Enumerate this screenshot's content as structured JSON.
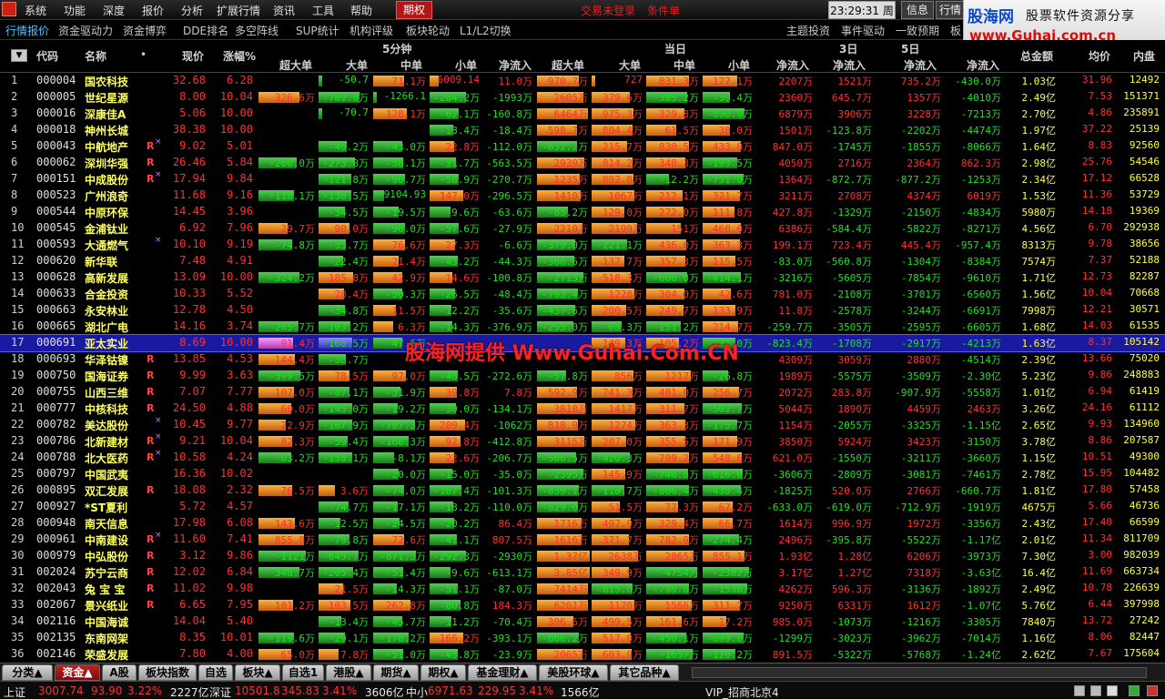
{
  "menubar": {
    "items": [
      "系统",
      "功能",
      "深度",
      "报价",
      "分析",
      "扩展行情",
      "资讯",
      "工具",
      "帮助"
    ],
    "active_tab": "期权",
    "login_status": "交易未登录",
    "condition_order": "条件单",
    "clock": "23:29:31 周二",
    "info_button": "信息",
    "quote_button": "行情"
  },
  "logo": {
    "brand": "股海网",
    "tagline": "股票软件资源分享",
    "url": "www.Guhai.com.cn"
  },
  "toolbar2": {
    "items": [
      "行情报价",
      "资金驱动力",
      "资金博弈",
      "DDE排名",
      "多空阵线",
      "SUP统计",
      "机构评级",
      "板块轮动",
      "L1/L2切换"
    ],
    "right_items": [
      "主题投资",
      "事件驱动",
      "一致预期",
      "板"
    ]
  },
  "header": {
    "code": "代码",
    "name": "名称",
    "dot": "•",
    "price": "现价",
    "change": "涨幅%",
    "group5": "5分钟",
    "group_today": "当日",
    "cols5": [
      "超大单",
      "大单",
      "中单",
      "小单",
      "净流入"
    ],
    "cols_today": [
      "超大单",
      "大单",
      "中单",
      "小单",
      "净流入"
    ],
    "d3": "3日",
    "d3b": "净流入",
    "d5": "5日",
    "d5b": "净流入",
    "net4": "净流入",
    "total_amount": "总金额",
    "avg": "均价",
    "inner": "内盘"
  },
  "rows": [
    {
      "n": "1",
      "code": "000004",
      "name": "国农科技",
      "price": "32.68",
      "chg": "6.28",
      "m": "",
      "f": [
        "",
        "-50.7",
        "71.1万",
        "6009.14",
        "11.0万",
        "970.7万",
        "727",
        "831.3万",
        "177.1万",
        "2207万",
        "1521万",
        "735.2万",
        "-430.0万",
        "1.03亿",
        "31.96",
        "12492"
      ]
    },
    {
      "n": "2",
      "code": "000005",
      "name": "世纪星源",
      "price": "8.00",
      "chg": "10.04",
      "m": "",
      "f": [
        "326.6万",
        "-769.0万",
        "-1266.1",
        "-284.2万",
        "-1993万",
        "2605万",
        "379.6万",
        "-585.2万",
        "-39.4万",
        "2360万",
        "645.7万",
        "1357万",
        "-4010万",
        "2.49亿",
        "7.53",
        "151371"
      ]
    },
    {
      "n": "3",
      "code": "000016",
      "name": "深康佳A",
      "price": "5.06",
      "chg": "10.00",
      "m": "",
      "f": [
        "",
        "-70.7",
        "128.1万",
        "-62.1万",
        "-160.8万",
        "6464万",
        "975.3万",
        "329.8万",
        "-890.0万",
        "6879万",
        "3906万",
        "3228万",
        "-7213万",
        "2.70亿",
        "4.86",
        "235891"
      ]
    },
    {
      "n": "4",
      "code": "000018",
      "name": "神州长城",
      "price": "38.38",
      "chg": "10.00",
      "m": "",
      "f": [
        "",
        "",
        "",
        "-18.4万",
        "-18.4万",
        "598.7万",
        "804.4万",
        "61.5万",
        "38.0万",
        "1501万",
        "-123.8万",
        "-2202万",
        "-4474万",
        "1.97亿",
        "37.22",
        "25139"
      ]
    },
    {
      "n": "5",
      "code": "000043",
      "name": "中航地产",
      "price": "9.02",
      "chg": "5.01",
      "m": "Rx",
      "f": [
        "",
        "-46.2万",
        "-43.0万",
        "22.8万",
        "-112.0万",
        "-632.2万",
        "215.7万",
        "830.5万",
        "433.0万",
        "847.0万",
        "-1745万",
        "-1855万",
        "-8066万",
        "1.64亿",
        "8.83",
        "92560"
      ]
    },
    {
      "n": "6",
      "code": "000062",
      "name": "深圳华强",
      "price": "26.46",
      "chg": "5.84",
      "m": "R",
      "f": [
        "-200.0万",
        "-273.8万",
        "-58.1万",
        "-31.7万",
        "-563.5万",
        "2939万",
        "814.2万",
        "348.3万",
        "-193.5万",
        "4050万",
        "2716万",
        "2364万",
        "862.3万",
        "2.98亿",
        "25.76",
        "54546"
      ]
    },
    {
      "n": "7",
      "code": "000151",
      "name": "中成股份",
      "price": "17.94",
      "chg": "9.84",
      "m": "Rx",
      "f": [
        "",
        "-121.8万",
        "-90.7万",
        "-58.9万",
        "-270.7万",
        "1235万",
        "892.0万",
        "-12.2万",
        "-751.0万",
        "1364万",
        "-872.7万",
        "-877.2万",
        "-1253万",
        "2.34亿",
        "17.12",
        "66528"
      ]
    },
    {
      "n": "8",
      "code": "000523",
      "name": "广州浪奇",
      "price": "11.68",
      "chg": "9.16",
      "m": "",
      "f": [
        "-118.1万",
        "-130.5万",
        "-9104.93",
        "147.0万",
        "-296.5万",
        "1410万",
        "1067万",
        "212.1万",
        "321.7万",
        "3211万",
        "2708万",
        "4374万",
        "6019万",
        "1.53亿",
        "11.36",
        "53729"
      ]
    },
    {
      "n": "9",
      "code": "000544",
      "name": "中原环保",
      "price": "14.45",
      "chg": "3.96",
      "m": "",
      "f": [
        "",
        "-34.5万",
        "-19.5万",
        "-9.6万",
        "-63.6万",
        "-85.2万",
        "129.0万",
        "272.0万",
        "111.8万",
        "427.8万",
        "-1329万",
        "-2150万",
        "-4834万",
        "5980万",
        "14.18",
        "19369"
      ]
    },
    {
      "n": "10",
      "code": "000545",
      "name": "金浦钛业",
      "price": "6.92",
      "chg": "7.96",
      "m": "",
      "f": [
        "29.7万",
        "90.0万",
        "-90.0万",
        "-57.6万",
        "-27.9万",
        "2210万",
        "2199万",
        "151万",
        "460.0万",
        "6386万",
        "-584.4万",
        "-5822万",
        "-8271万",
        "4.56亿",
        "6.70",
        "292938"
      ]
    },
    {
      "n": "11",
      "code": "000593",
      "name": "大通燃气",
      "price": "10.10",
      "chg": "9.19",
      "m": "x",
      "f": [
        "-74.8万",
        "-35.7万",
        "76.6万",
        "27.3万",
        "-6.6万",
        "-379.0万",
        "-221.1万",
        "436.0万",
        "363.3万",
        "199.1万",
        "723.4万",
        "445.4万",
        "-957.4万",
        "8313万",
        "9.78",
        "38656"
      ]
    },
    {
      "n": "12",
      "code": "000620",
      "name": "新华联",
      "price": "7.48",
      "chg": "4.91",
      "m": "",
      "f": [
        "",
        "-22.4万",
        "21.4万",
        "-43.2万",
        "-44.3万",
        "-366.6万",
        "137.7万",
        "357.3万",
        "115.5万",
        "-83.0万",
        "-560.8万",
        "-1304万",
        "-8384万",
        "7574万",
        "7.37",
        "52188"
      ]
    },
    {
      "n": "13",
      "code": "000628",
      "name": "高新发展",
      "price": "13.09",
      "chg": "10.00",
      "m": "",
      "f": [
        "-324.2万",
        "185.8万",
        "42.9万",
        "14.6万",
        "-100.8万",
        "-2713万",
        "518.3万",
        "-606.8万",
        "-414.1万",
        "-3216万",
        "-5605万",
        "-7854万",
        "-9610万",
        "1.71亿",
        "12.73",
        "82287"
      ]
    },
    {
      "n": "14",
      "code": "000633",
      "name": "合金投资",
      "price": "10.33",
      "chg": "5.52",
      "m": "",
      "f": [
        "",
        "28.4万",
        "-50.3万",
        "-26.5万",
        "-48.4万",
        "-793.4万",
        "1228万",
        "304.0万",
        "42.6万",
        "781.0万",
        "-2108万",
        "-3701万",
        "-6560万",
        "1.56亿",
        "10.04",
        "70668"
      ]
    },
    {
      "n": "15",
      "code": "000663",
      "name": "永安林业",
      "price": "12.78",
      "chg": "4.50",
      "m": "",
      "f": [
        "",
        "-34.8万",
        "11.5万",
        "-12.2万",
        "-35.6万",
        "-437.6万",
        "200.5万",
        "249.7万",
        "133.9万",
        "11.8万",
        "-2578万",
        "-3244万",
        "-6691万",
        "7998万",
        "12.21",
        "30571"
      ]
    },
    {
      "n": "16",
      "code": "000665",
      "name": "湖北广电",
      "price": "14.16",
      "chg": "3.74",
      "m": "",
      "f": [
        "-265.7万",
        "-103.2万",
        "6.3万",
        "-14.3万",
        "-376.9万",
        "-255.0万",
        "-68.3万",
        "-151.2万",
        "214.7万",
        "-259.7万",
        "-3505万",
        "-2595万",
        "-6605万",
        "1.68亿",
        "14.03",
        "61535"
      ]
    },
    {
      "n": "17",
      "code": "000691",
      "name": "亚太实业",
      "price": "8.69",
      "chg": "10.00",
      "m": "",
      "sel": true,
      "f": [
        "91.4万",
        "-168.5万",
        "-47.6万",
        "",
        "",
        "",
        "149.3万",
        "105.2万",
        "-121.0万",
        "-823.4万",
        "-1708万",
        "-2917万",
        "-4213万",
        "1.63亿",
        "8.37",
        "105142"
      ]
    },
    {
      "n": "18",
      "code": "000693",
      "name": "华泽钴镍",
      "price": "13.85",
      "chg": "4.53",
      "m": "R",
      "f": [
        "144.4万",
        "-38.7万",
        "",
        "",
        "",
        "",
        "",
        "",
        "",
        "4309万",
        "3059万",
        "2880万",
        "-4514万",
        "2.39亿",
        "13.66",
        "75020"
      ]
    },
    {
      "n": "19",
      "code": "000750",
      "name": "国海证券",
      "price": "9.99",
      "chg": "3.63",
      "m": "R",
      "f": [
        "-399.5万",
        "78.5万",
        "97.0万",
        "-48.5万",
        "-272.6万",
        "-57.8万",
        "856万",
        "1217万",
        "-26.8万",
        "1989万",
        "-5575万",
        "-3509万",
        "-2.30亿",
        "5.23亿",
        "9.86",
        "248883"
      ]
    },
    {
      "n": "20",
      "code": "000755",
      "name": "山西三维",
      "price": "7.07",
      "chg": "7.77",
      "m": "R",
      "f": [
        "107.0万",
        "-87.1万",
        "-31.9万",
        "39.8万",
        "7.8万",
        "592.9万",
        "741.3万",
        "481.0万",
        "256.7万",
        "2072万",
        "283.8万",
        "-907.9万",
        "-5558万",
        "1.01亿",
        "6.94",
        "61419"
      ]
    },
    {
      "n": "21",
      "code": "000777",
      "name": "中核科技",
      "price": "24.50",
      "chg": "4.88",
      "m": "R",
      "f": [
        "60.0万",
        "-145.0万",
        "-19.2万",
        "-30.0万",
        "-134.1万",
        "3818万",
        "1417万",
        "311.7万",
        "-502.7万",
        "5044万",
        "1890万",
        "4459万",
        "2463万",
        "3.26亿",
        "24.16",
        "61112"
      ]
    },
    {
      "n": "22",
      "code": "000782",
      "name": "美达股份",
      "price": "10.45",
      "chg": "9.77",
      "m": "x",
      "f": [
        "22.9万",
        "-167.9万",
        "-707.3万",
        "209.4万",
        "-1062万",
        "818.9万",
        "1274万",
        "363.3万",
        "-175.7万",
        "1154万",
        "-2055万",
        "-3325万",
        "-1.15亿",
        "2.65亿",
        "9.93",
        "134960"
      ]
    },
    {
      "n": "23",
      "code": "000786",
      "name": "北新建材",
      "price": "9.21",
      "chg": "10.04",
      "m": "Rx",
      "f": [
        "82.3万",
        "-59.4万",
        "-168.3万",
        "92.8万",
        "-412.8万",
        "3115万",
        "207.0万",
        "355.5万",
        "171.9万",
        "3850万",
        "5924万",
        "3423万",
        "-3150万",
        "3.78亿",
        "8.86",
        "207587"
      ]
    },
    {
      "n": "24",
      "code": "000788",
      "name": "北大医药",
      "price": "10.58",
      "chg": "4.24",
      "m": "Rx",
      "f": [
        "-63.2万",
        "-158.1万",
        "-8.1万",
        "22.6万",
        "-206.7万",
        "-506.5万",
        "-420.3万",
        "799.2万",
        "548.6万",
        "621.0万",
        "-1550万",
        "-3211万",
        "-3660万",
        "1.15亿",
        "10.51",
        "49300"
      ]
    },
    {
      "n": "25",
      "code": "000797",
      "name": "中国武夷",
      "price": "16.36",
      "chg": "10.02",
      "m": "",
      "f": [
        "",
        "",
        "-20.0万",
        "-15.0万",
        "-35.0万",
        "-2395万",
        "145.9万",
        "-740.8万",
        "-616.0万",
        "-3606万",
        "-2809万",
        "-3081万",
        "-7461万",
        "2.78亿",
        "15.95",
        "104482"
      ]
    },
    {
      "n": "26",
      "code": "000895",
      "name": "双汇发展",
      "price": "18.08",
      "chg": "2.32",
      "m": "R",
      "f": [
        "76.5万",
        "3.6万",
        "-74.0万",
        "-107.4万",
        "-101.3万",
        "-839.1万",
        "-118.7万",
        "-866.4万",
        "-438.4万",
        "-1825万",
        "520.0万",
        "2766万",
        "-660.7万",
        "1.81亿",
        "17.80",
        "57458"
      ]
    },
    {
      "n": "27",
      "code": "000927",
      "name": "*ST夏利",
      "price": "5.72",
      "chg": "4.57",
      "m": "",
      "f": [
        "",
        "-74.7万",
        "-17.1万",
        "-18.2万",
        "-110.0万",
        "-829.0万",
        "51.5万",
        "77.3万",
        "67.2万",
        "-633.0万",
        "-619.0万",
        "-712.9万",
        "-1919万",
        "4675万",
        "5.66",
        "46736"
      ]
    },
    {
      "n": "28",
      "code": "000948",
      "name": "南天信息",
      "price": "17.98",
      "chg": "6.08",
      "m": "",
      "f": [
        "143.6万",
        "-12.5万",
        "-24.5万",
        "-20.2万",
        "86.4万",
        "1716万",
        "497.9万",
        "329.4万",
        "66.7万",
        "1614万",
        "996.9万",
        "1972万",
        "-3356万",
        "2.43亿",
        "17.40",
        "66599"
      ]
    },
    {
      "n": "29",
      "code": "000961",
      "name": "中南建设",
      "price": "11.60",
      "chg": "7.41",
      "m": "Rx",
      "f": [
        "855.8万",
        "-79.8万",
        "72.6万",
        "-41.1万",
        "807.5万",
        "1616万",
        "371.7万",
        "782.9万",
        "-274.4万",
        "2496万",
        "-395.8万",
        "-5522万",
        "-1.17亿",
        "2.01亿",
        "11.34",
        "811709"
      ]
    },
    {
      "n": "30",
      "code": "000979",
      "name": "中弘股份",
      "price": "3.12",
      "chg": "9.86",
      "m": "R",
      "f": [
        "-1121万",
        "-645.7万",
        "-871.3万",
        "-292.3万",
        "-2930万",
        "1.37亿",
        "2638万",
        "2065万",
        "855.1万",
        "1.93亿",
        "1.28亿",
        "6206万",
        "-3973万",
        "7.30亿",
        "3.00",
        "982039"
      ]
    },
    {
      "n": "31",
      "code": "002024",
      "name": "苏宁云商",
      "price": "12.02",
      "chg": "6.84",
      "m": "R",
      "f": [
        "-348.7万",
        "-205.4万",
        "-51.4万",
        "-9.6万",
        "-613.1万",
        "3.85亿",
        "349.9万",
        "-4754万",
        "-2382万",
        "3.17亿",
        "1.27亿",
        "7318万",
        "-3.63亿",
        "16.4亿",
        "11.69",
        "663734"
      ]
    },
    {
      "n": "32",
      "code": "002043",
      "name": "兔 宝 宝",
      "price": "11.02",
      "chg": "9.98",
      "m": "R",
      "f": [
        "",
        "21.5万",
        "-14.3万",
        "-51.1万",
        "-87.0万",
        "7414万",
        "-815.0万",
        "-799.8万",
        "-1538万",
        "4262万",
        "596.3万",
        "-3136万",
        "-1892万",
        "2.49亿",
        "10.78",
        "226639"
      ]
    },
    {
      "n": "33",
      "code": "002067",
      "name": "景兴纸业",
      "price": "6.65",
      "chg": "7.95",
      "m": "R",
      "f": [
        "101.2万",
        "103.5万",
        "262.8万",
        "-80.8万",
        "184.3万",
        "6201万",
        "1170万",
        "1566万",
        "311.7万",
        "9250万",
        "6331万",
        "1612万",
        "-1.07亿",
        "5.76亿",
        "6.44",
        "397998"
      ]
    },
    {
      "n": "34",
      "code": "002116",
      "name": "中国海诚",
      "price": "14.04",
      "chg": "5.40",
      "m": "",
      "f": [
        "",
        "-13.4万",
        "-45.7万",
        "-11.2万",
        "-70.4万",
        "306.6万",
        "499.5万",
        "161.6万",
        "17.2万",
        "985.0万",
        "-1073万",
        "-1216万",
        "-3305万",
        "7840万",
        "13.72",
        "27242"
      ]
    },
    {
      "n": "35",
      "code": "002135",
      "name": "东南网架",
      "price": "8.35",
      "chg": "10.01",
      "m": "",
      "f": [
        "-119.6万",
        "-29.1万",
        "-178.2万",
        "166.2万",
        "-393.1万",
        "-866.2万",
        "517.0万",
        "-450.1万",
        "-699.6万",
        "-1299万",
        "-3023万",
        "-3962万",
        "-7014万",
        "1.16亿",
        "8.06",
        "82447"
      ]
    },
    {
      "n": "36",
      "code": "002146",
      "name": "荣盛发展",
      "price": "7.80",
      "chg": "4.00",
      "m": "",
      "f": [
        "65.0万",
        "7.8万",
        "-51.0万",
        "-45.8万",
        "-23.9万",
        "2065万",
        "603.9万",
        "-1657万",
        "-120.2万",
        "891.5万",
        "-5322万",
        "-5768万",
        "-1.24亿",
        "2.62亿",
        "7.67",
        "175604"
      ]
    }
  ],
  "watermark": "股海网提供 Www.Guhai.Com.CN",
  "tabs": [
    "分类▲",
    "资金▲",
    "A股",
    "板块指数",
    "自选",
    "板块▲",
    "自选1",
    "港股▲",
    "期货▲",
    "期权▲",
    "基金理财▲",
    "美股环球▲",
    "其它品种▲"
  ],
  "status": {
    "sh_label": "上证",
    "sh_val": "3007.74",
    "sh_chg": "93.90",
    "sh_pct": "3.22%",
    "sh_amt": "2227亿",
    "sz_label": "深证",
    "sz_val": "10501.8",
    "sz_chg": "345.83",
    "sz_pct": "3.41%",
    "sz_amt": "3606亿",
    "zx_label": "中小",
    "zx_val": "6971.63",
    "zx_chg": "229.95",
    "zx_pct": "3.41%",
    "zx_amt": "1566亿",
    "broker": "VIP_招商北京4"
  }
}
